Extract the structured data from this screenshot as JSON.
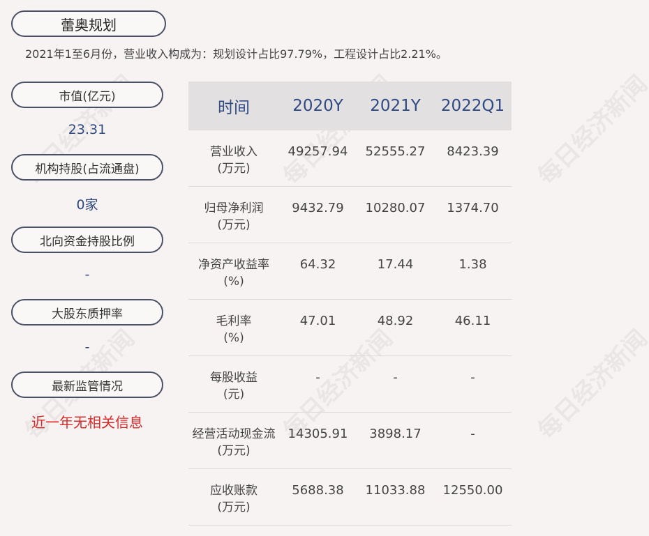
{
  "company": "蕾奥规划",
  "summary": "2021年1至6月份，营业收入构成为：规划设计占比97.79%，工程设计占比2.21%。",
  "sidebar": [
    {
      "label": "市值(亿元)",
      "value": "23.31"
    },
    {
      "label": "机构持股(占流通盘)",
      "value": "0家"
    },
    {
      "label": "北向资金持股比例",
      "value": "-"
    },
    {
      "label": "大股东质押率",
      "value": "-"
    },
    {
      "label": "最新监管情况",
      "value": "近一年无相关信息"
    }
  ],
  "table": {
    "headers": [
      "时间",
      "2020Y",
      "2021Y",
      "2022Q1"
    ],
    "rows": [
      {
        "label": "营业收入",
        "unit": "(万元)",
        "values": [
          "49257.94",
          "52555.27",
          "8423.39"
        ]
      },
      {
        "label": "归母净利润",
        "unit": "(万元)",
        "values": [
          "9432.79",
          "10280.07",
          "1374.70"
        ]
      },
      {
        "label": "净资产收益率",
        "unit": "(%)",
        "values": [
          "64.32",
          "17.44",
          "1.38"
        ]
      },
      {
        "label": "毛利率",
        "unit": "(%)",
        "values": [
          "47.01",
          "48.92",
          "46.11"
        ]
      },
      {
        "label": "每股收益",
        "unit": "(元)",
        "values": [
          "-",
          "-",
          "-"
        ]
      },
      {
        "label": "经营活动现金流",
        "unit": "(万元)",
        "values": [
          "14305.91",
          "3898.17",
          "-"
        ]
      },
      {
        "label": "应收账款",
        "unit": "(万元)",
        "values": [
          "5688.38",
          "11033.88",
          "12550.00"
        ]
      }
    ]
  },
  "watermark": "每日经济新闻",
  "colors": {
    "accent": "#304a83",
    "alert": "#d92a2a",
    "background": "#f7f3f2"
  }
}
